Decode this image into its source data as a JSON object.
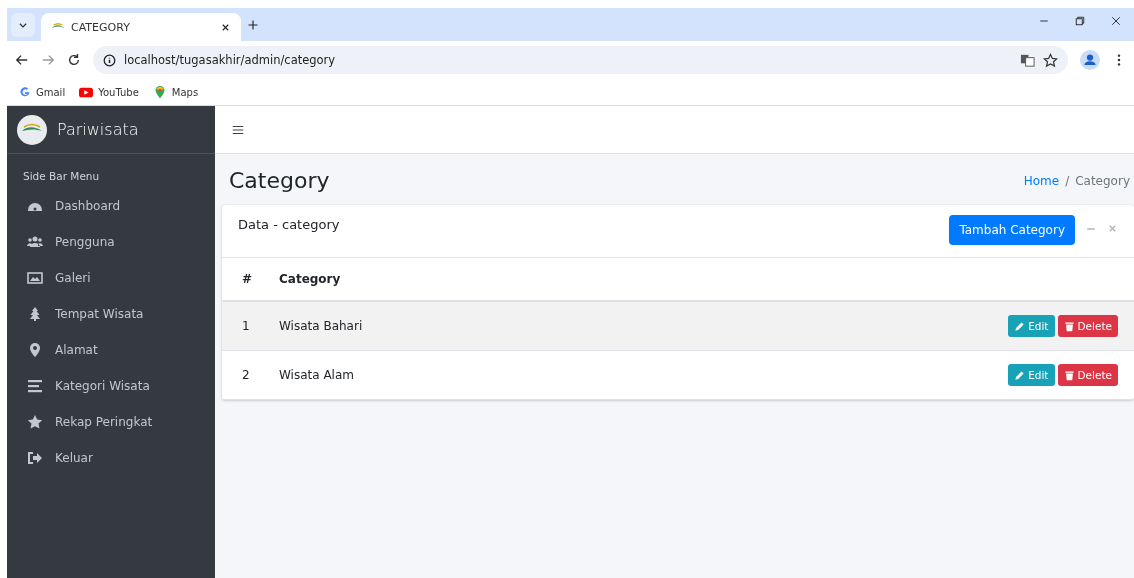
{
  "browser": {
    "tab_title": "CATEGORY",
    "url": "localhost/tugasakhir/admin/category",
    "bookmarks": [
      "Gmail",
      "YouTube",
      "Maps"
    ]
  },
  "brand": "Pariwisata",
  "sidebar": {
    "heading": "Side Bar Menu",
    "items": [
      {
        "label": "Dashboard"
      },
      {
        "label": "Pengguna"
      },
      {
        "label": "Galeri"
      },
      {
        "label": "Tempat Wisata"
      },
      {
        "label": "Alamat"
      },
      {
        "label": "Kategori Wisata"
      },
      {
        "label": "Rekap Peringkat"
      },
      {
        "label": "Keluar"
      }
    ]
  },
  "page_title": "Category",
  "breadcrumb": [
    "Home",
    "/",
    "Category"
  ],
  "card": {
    "title": "Data - category",
    "add_button": "Tambah Category"
  },
  "table": {
    "columns": [
      "#",
      "Category"
    ],
    "rows": [
      {
        "cells": [
          "1",
          "Wisata Bahari"
        ],
        "highlighted": true,
        "actions": [
          "Edit",
          "Delete"
        ]
      },
      {
        "cells": [
          "2",
          "Wisata Alam"
        ],
        "highlighted": false,
        "actions": [
          "Edit",
          "Delete"
        ]
      }
    ]
  }
}
